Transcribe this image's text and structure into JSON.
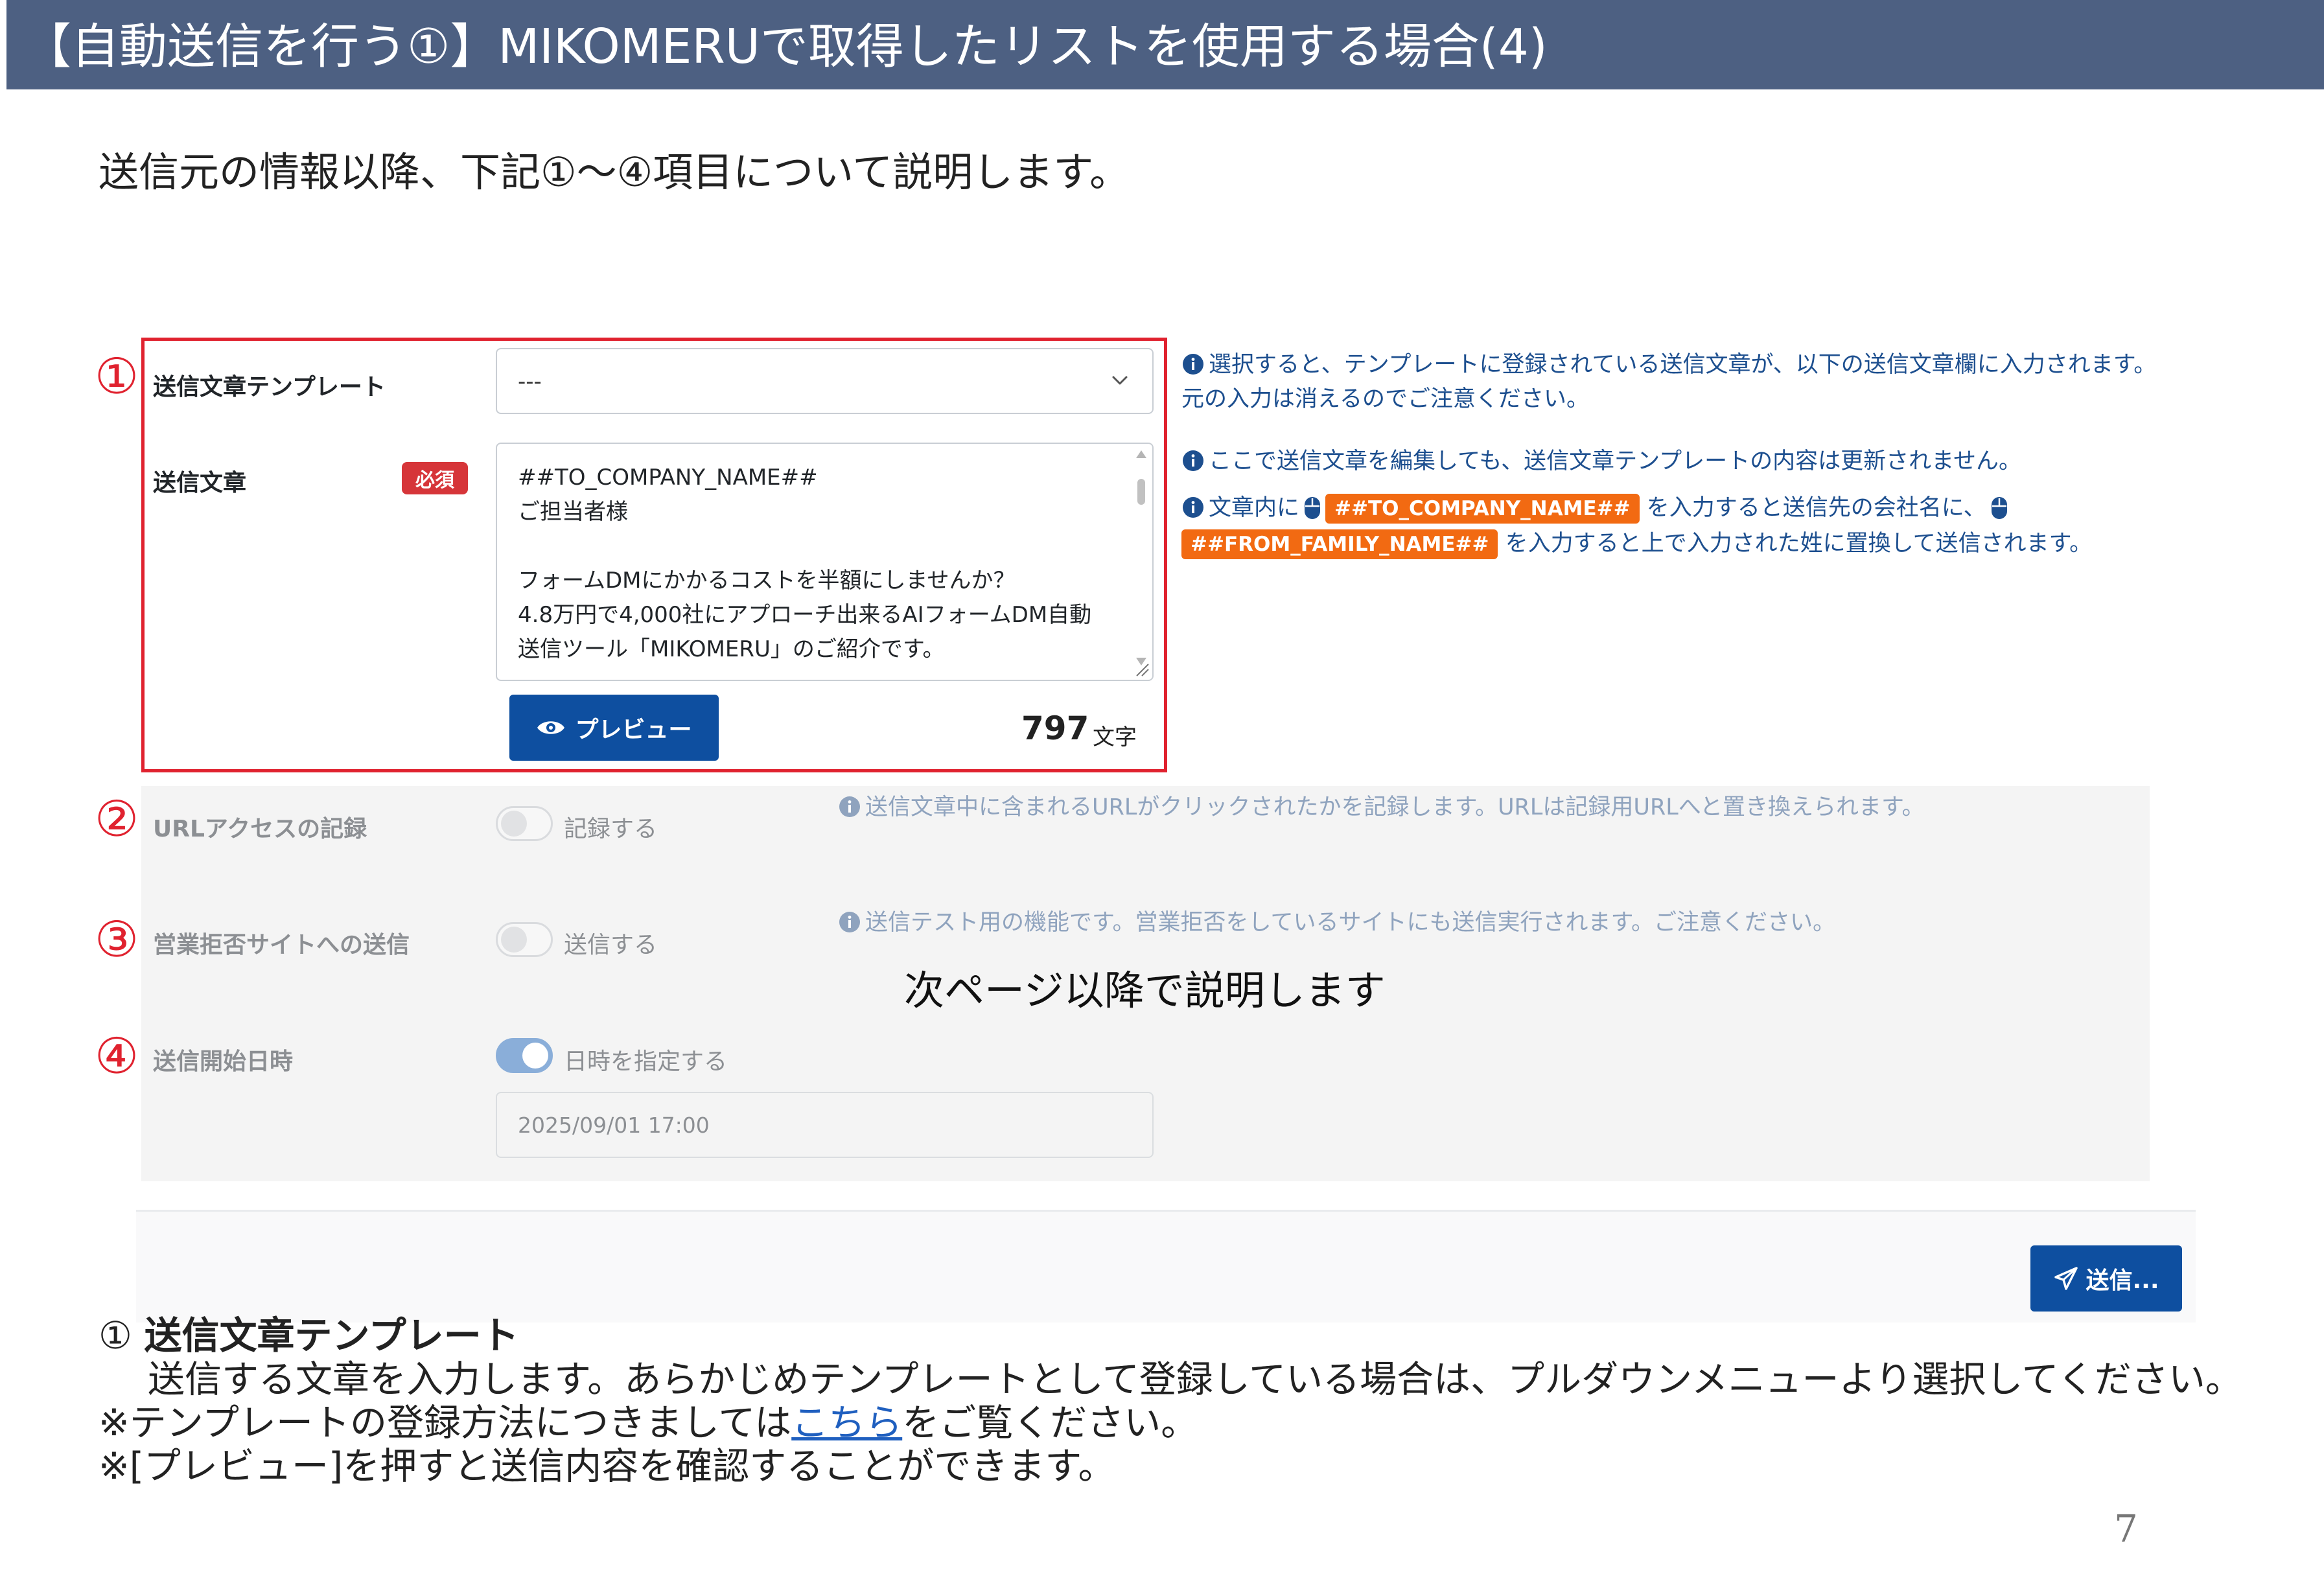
{
  "header": {
    "title": "【自動送信を行う①】MIKOMERUで取得したリストを使用する場合(4)"
  },
  "subtitle": "送信元の情報以降、下記①～④項目について説明します。",
  "markers": [
    "①",
    "②",
    "③",
    "④"
  ],
  "form": {
    "template": {
      "label": "送信文章テンプレート",
      "value": "---",
      "help": "選択すると、テンプレートに登録されている送信文章が、以下の送信文章欄に入力されます。元の入力は消えるのでご注意ください。"
    },
    "message": {
      "label": "送信文章",
      "required": "必須",
      "text": "##TO_COMPANY_NAME##\nご担当者様\n\nフォームDMにかかるコストを半額にしませんか？\n4.8万円で4,000社にアプローチ出来るAIフォームDM自動送信ツール「MIKOMERU」のご紹介です。",
      "help1": "ここで送信文章を編集しても、送信文章テンプレートの内容は更新されません。",
      "help2_a": "文章内に",
      "tag_company": "##TO_COMPANY_NAME##",
      "help2_b": "を入力すると送信先の会社名に、",
      "tag_family": "##FROM_FAMILY_NAME##",
      "help2_c": "を入力すると上で入力された姓に置換して送信されます。",
      "preview_label": "プレビュー",
      "char_count": "797",
      "char_unit": "文字"
    },
    "url_access": {
      "label": "URLアクセスの記録",
      "toggle_label": "記録する",
      "enabled": false,
      "help": "送信文章中に含まれるURLがクリックされたかを記録します。URLは記録用URLへと置き換えられます。"
    },
    "refusal_sites": {
      "label": "営業拒否サイトへの送信",
      "toggle_label": "送信する",
      "enabled": false,
      "help": "送信テスト用の機能です。営業拒否をしているサイトにも送信実行されます。ご注意ください。"
    },
    "start_datetime": {
      "label": "送信開始日時",
      "toggle_label": "日時を指定する",
      "enabled": true,
      "value": "2025/09/01 17:00"
    },
    "send_label": "送信..."
  },
  "next_page_note": "次ページ以降で説明します",
  "description": {
    "number": "①",
    "title": "送信文章テンプレート",
    "line1": "送信する文章を入力します。あらかじめテンプレートとして登録している場合は、プルダウンメニューより選択してください。",
    "line2_a": "※テンプレートの登録方法につきましては",
    "line2_link": "こちら",
    "line2_b": "をご覧ください。",
    "line3": "※[プレビュー]を押すと送信内容を確認することができます。"
  },
  "page_number": "7",
  "colors": {
    "header_bg": "#4d6082",
    "accent_red": "#e0222f",
    "primary_blue": "#0e4fa0",
    "tag_orange": "#f26a12",
    "help_blue": "#1d4f8f"
  }
}
